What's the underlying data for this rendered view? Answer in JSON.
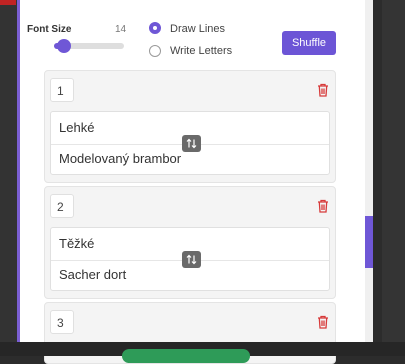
{
  "settings": {
    "font_size_label": "Font Size",
    "font_size_value": "14",
    "font_size_fraction": 0.2,
    "options": [
      {
        "label": "Draw Lines",
        "selected": true
      },
      {
        "label": "Write Letters",
        "selected": false
      }
    ],
    "shuffle_label": "Shuffle"
  },
  "items": [
    {
      "number": "1",
      "top": "Lehké",
      "bottom": "Modelovaný brambor"
    },
    {
      "number": "2",
      "top": "Těžké",
      "bottom": "Sacher dort"
    },
    {
      "number": "3"
    }
  ],
  "colors": {
    "accent": "#6c55d6",
    "delete": "#d73a3a",
    "confirm": "#2e9b58"
  },
  "icons": {
    "delete": "trash-icon",
    "swap": "swap-vertical-icon"
  }
}
